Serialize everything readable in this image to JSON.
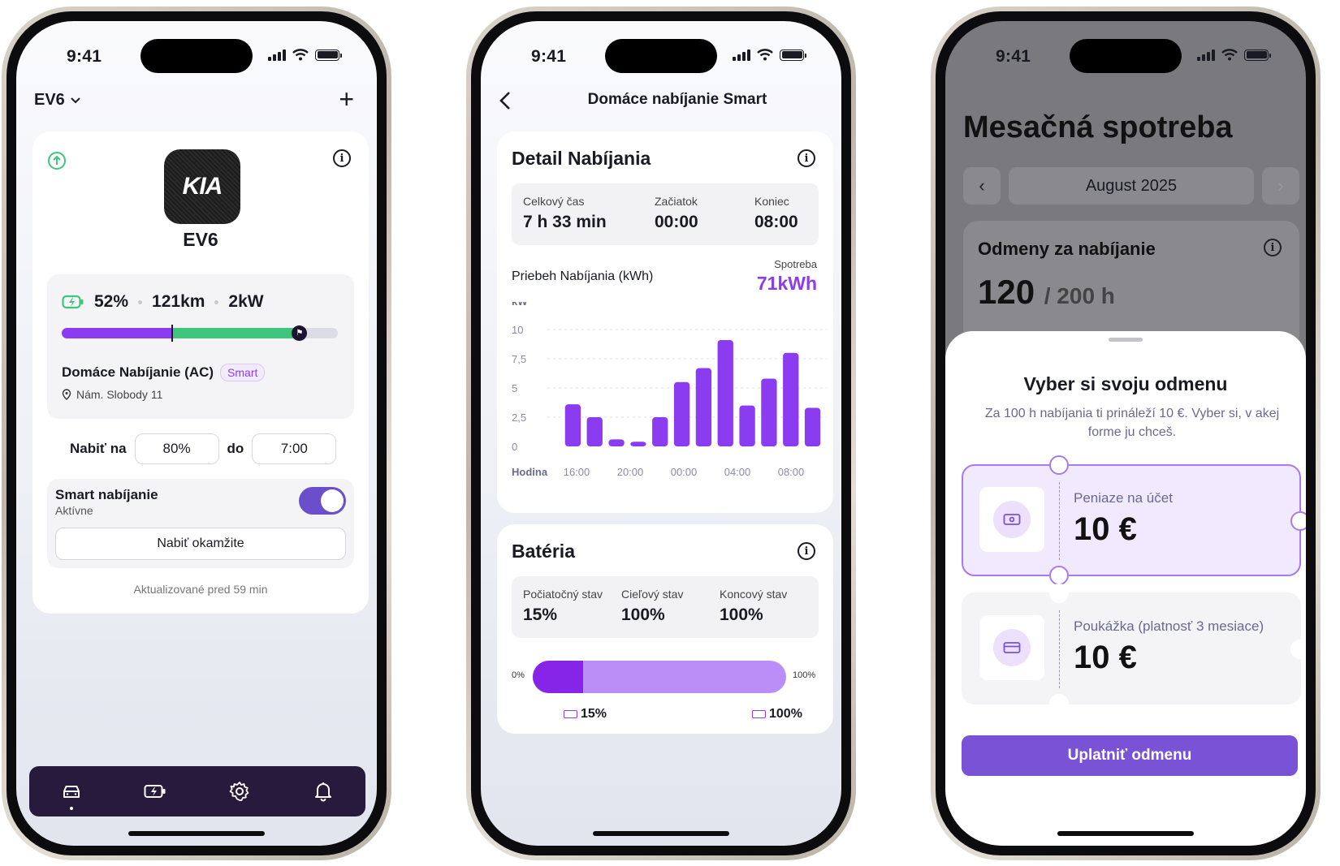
{
  "status": {
    "time": "9:41"
  },
  "screen1": {
    "vehicle_selector": "EV6",
    "logo_text": "KIA",
    "vehicle_name": "EV6",
    "battery_percent": "52%",
    "range": "121km",
    "power": "2kW",
    "charge_level_fraction": 0.4,
    "target_level_fraction": 0.86,
    "location_title": "Domáce Nabíjanie (AC)",
    "location_badge": "Smart",
    "location_address": "Nám. Slobody 11",
    "charge_to_label": "Nabiť na",
    "charge_to_value": "80%",
    "until_label": "do",
    "until_value": "7:00",
    "smart_title": "Smart nabíjanie",
    "smart_status": "Aktívne",
    "smart_enabled": true,
    "charge_now_button": "Nabiť okamžite",
    "updated_text": "Aktualizované pred 59 min",
    "tabs": [
      "car-icon",
      "battery-charge-icon",
      "gear-icon",
      "bell-icon"
    ]
  },
  "screen2": {
    "title": "Domáce nabíjanie Smart",
    "detail_title": "Detail Nabíjania",
    "total_time_label": "Celkový čas",
    "total_time_value": "7 h 33 min",
    "start_label": "Začiatok",
    "start_value": "00:00",
    "end_label": "Koniec",
    "end_value": "08:00",
    "chart_title": "Priebeh Nabíjania (kWh)",
    "consumption_label": "Spotreba",
    "consumption_value": "71kWh",
    "battery_title": "Batéria",
    "initial_label": "Počiatočný stav",
    "initial_value": "15%",
    "target_label": "Cieľový stav",
    "target_value": "100%",
    "final_label": "Koncový stav",
    "final_value": "100%",
    "bar_min": "0%",
    "bar_max": "100%",
    "mark_start": "15%",
    "mark_end": "100%",
    "battery_fill_fraction": 0.2,
    "accent": "#8c3cf0"
  },
  "chart_data": {
    "type": "bar",
    "title": "",
    "ylabel": "kW",
    "xlabel": "Hodina",
    "ylim": [
      0,
      10
    ],
    "yticks": [
      "10",
      "7,5",
      "5",
      "2,5",
      "0"
    ],
    "xticks": [
      "16:00",
      "20:00",
      "00:00",
      "04:00",
      "08:00"
    ],
    "values": [
      3.6,
      2.5,
      0.6,
      0.4,
      2.5,
      5.5,
      6.7,
      9.1,
      3.5,
      5.8,
      8.0,
      3.3
    ]
  },
  "screen3": {
    "title": "Mesačná spotreba",
    "month": "August 2025",
    "rewards_title": "Odmeny za nabíjanie",
    "rewards_value": "120",
    "rewards_total": "/ 200 h",
    "sheet_title": "Vyber si svoju odmenu",
    "sheet_subtitle": "Za 100 h nabíjania ti prináleží 10 €. Vyber si, v akej forme ju chceš.",
    "option1_label": "Peniaze na účet",
    "option1_value": "10 €",
    "option2_label": "Poukážka (platnosť 3 mesiace)",
    "option2_value": "10 €",
    "cta": "Uplatniť odmenu"
  }
}
